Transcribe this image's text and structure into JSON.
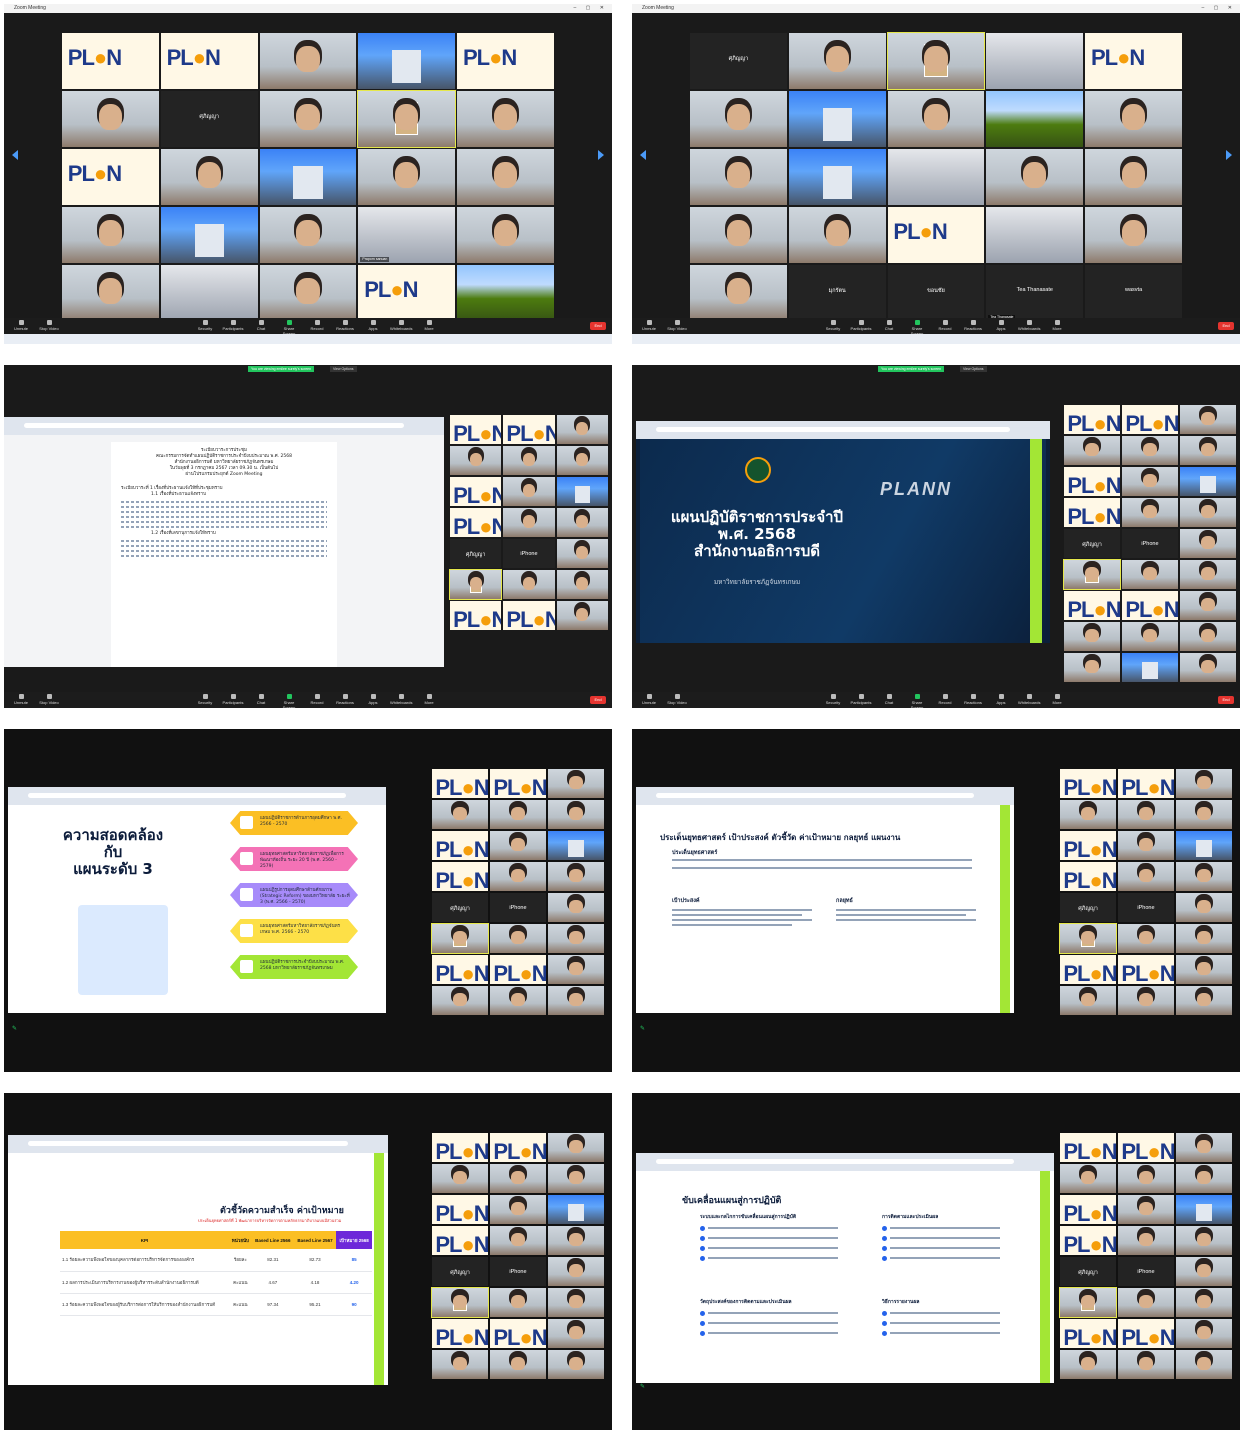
{
  "window_title": "Zoom Meeting",
  "toolbar": {
    "unmute": "Unmute",
    "stop_video": "Stop Video",
    "security": "Security",
    "participants": "Participants",
    "chat": "Chat",
    "share_screen": "Share Screen",
    "record": "Record",
    "reactions": "Reactions",
    "apps": "Apps",
    "whiteboards": "Whiteboards",
    "more": "More",
    "end": "End"
  },
  "screenshots": {
    "s1": {
      "tiles": [
        {
          "kind": "plan",
          "name": ""
        },
        {
          "kind": "plan",
          "name": ""
        },
        {
          "kind": "face",
          "name": ""
        },
        {
          "kind": "bldg",
          "name": ""
        },
        {
          "kind": "plan",
          "name": ""
        },
        {
          "kind": "face",
          "name": ""
        },
        {
          "kind": "dark",
          "big": "ศุภิญญา",
          "name": ""
        },
        {
          "kind": "face",
          "name": ""
        },
        {
          "kind": "active",
          "name": ""
        },
        {
          "kind": "face",
          "name": ""
        },
        {
          "kind": "plan",
          "name": ""
        },
        {
          "kind": "face",
          "name": ""
        },
        {
          "kind": "bldg",
          "name": ""
        },
        {
          "kind": "face",
          "name": ""
        },
        {
          "kind": "face",
          "name": ""
        },
        {
          "kind": "face",
          "name": ""
        },
        {
          "kind": "bldg",
          "name": ""
        },
        {
          "kind": "face",
          "name": ""
        },
        {
          "kind": "office",
          "name": "Praporn sanuan"
        },
        {
          "kind": "face",
          "name": ""
        },
        {
          "kind": "face",
          "name": ""
        },
        {
          "kind": "office",
          "name": ""
        },
        {
          "kind": "face",
          "name": ""
        },
        {
          "kind": "plan",
          "name": ""
        },
        {
          "kind": "mount",
          "name": ""
        }
      ]
    },
    "s2": {
      "tiles": [
        {
          "kind": "dark",
          "big": "ศุภิญญา",
          "name": ""
        },
        {
          "kind": "face",
          "name": ""
        },
        {
          "kind": "active",
          "name": ""
        },
        {
          "kind": "office",
          "name": ""
        },
        {
          "kind": "plan",
          "name": ""
        },
        {
          "kind": "face",
          "name": ""
        },
        {
          "kind": "bldg",
          "name": ""
        },
        {
          "kind": "face",
          "name": ""
        },
        {
          "kind": "mount",
          "name": ""
        },
        {
          "kind": "face",
          "name": ""
        },
        {
          "kind": "face",
          "name": ""
        },
        {
          "kind": "bldg",
          "name": ""
        },
        {
          "kind": "office",
          "name": ""
        },
        {
          "kind": "face",
          "name": ""
        },
        {
          "kind": "face",
          "name": ""
        },
        {
          "kind": "face",
          "name": ""
        },
        {
          "kind": "face",
          "name": ""
        },
        {
          "kind": "plan",
          "name": ""
        },
        {
          "kind": "office",
          "name": ""
        },
        {
          "kind": "face",
          "name": ""
        },
        {
          "kind": "face",
          "name": ""
        },
        {
          "kind": "dark",
          "big": "มุกรัตน",
          "name": ""
        },
        {
          "kind": "dark",
          "big": "ขอนชัย",
          "name": ""
        },
        {
          "kind": "dark",
          "big": "Tea Thanasate",
          "name": "Tea Thanasate"
        },
        {
          "kind": "dark",
          "big": "wasvta",
          "name": ""
        }
      ]
    },
    "s3": {
      "banner": "You are viewing emilee surely's screen",
      "view_options": "View Options",
      "doc_heading": "ระเบียบวาระการประชุม",
      "doc_line1": "คณะกรรมการจัดทำแผนปฏิบัติราชการประจำปีงบประมาณ พ.ศ. 2568",
      "doc_line2": "สำนักงานอธิการบดี มหาวิทยาลัยราชภัฏจันทรเกษม",
      "doc_line3": "ในวันพุธที่ 3 กรกฎาคม 2567 เวลา 09.30 น. เป็นต้นไป",
      "doc_line4": "ผ่านโปรแกรมประยุกต์ Zoom Meeting",
      "doc_agenda1": "ระเบียบวาระที่ 1 เรื่องที่ประธานแจ้งให้ที่ประชุมทราบ",
      "doc_sub1": "1.1 เรื่องที่ประธานแจ้งทราบ",
      "doc_sub2": "1.2 เรื่องที่เลขานุการแจ้งให้ทราบ",
      "side_names": [
        "ศุภิญญา",
        "iPhone",
        "ศักดิ์ชัย ศิริชัยกุล",
        "Praporn sanua..."
      ]
    },
    "s4": {
      "banner": "You are viewing emilee surely's screen",
      "view_options": "View Options",
      "slide_title_1": "แผนปฏิบัติราชการประจำปี",
      "slide_title_2": "พ.ศ. 2568",
      "slide_title_3": "สำนักงานอธิการบดี",
      "slide_sub": "มหาวิทยาลัยราชภัฏจันทรเกษม",
      "watermark": "PLANN",
      "side_names": [
        "ศุภิญญา",
        "iPhone",
        "มหาวิทยาลัยราชภัฏ..."
      ]
    },
    "s5": {
      "slide_title_1": "ความสอดคล้อง",
      "slide_title_2": "กับ",
      "slide_title_3": "แผนระดับ 3",
      "pills": [
        "แผนปฏิบัติราชการด้านการอุดมศึกษา พ.ศ. 2566 - 2570",
        "แผนยุทธศาสตร์มหาวิทยาลัยราชภัฏเพื่อการพัฒนาท้องถิ่น ระยะ 20 ปี (พ.ศ. 2560 - 2579)",
        "แผนปฏิรูปการอุดมศึกษาด้านศักยภาพ (Strategic Reform) ของมหาวิทยาลัย ระยะที่ 3 (พ.ศ. 2566 - 2570)",
        "แผนยุทธศาสตร์มหาวิทยาลัยราชภัฏจันทรเกษม พ.ศ. 2566 - 2570",
        "แผนปฏิบัติราชการประจำปีงบประมาณ พ.ศ. 2568 มหาวิทยาลัยราชภัฏจันทรเกษม"
      ],
      "side_names": [
        "ศุภิญญา",
        "iPhone",
        "มหาวิทยาลัยราชภัฏ..."
      ]
    },
    "s6": {
      "slide_heading": "ประเด็นยุทธศาสตร์ เป้าประสงค์ ตัวชี้วัด ค่าเป้าหมาย กลยุทธ์ แผนงาน",
      "sec1": "ประเด็นยุทธศาสตร์",
      "sec2": "เป้าประสงค์",
      "sec3": "กลยุทธ์",
      "side_names": [
        "ศุภิญญา",
        "iPhone",
        "มหาวิทยาลัยราชภัฏ..."
      ]
    },
    "s7": {
      "slide_heading": "ตัวชี้วัดความสำเร็จ ค่าเป้าหมาย",
      "slide_sub": "ประเด็นยุทธศาสตร์ที่ 1 พัฒนาการบริหารจัดการตามหลักธรรมาภิบาลแบบมีส่วนร่วม",
      "columns": [
        "KPI",
        "หน่วยนับ",
        "Based Line 2566",
        "Based Line 2567",
        "เป้าหมาย 2568"
      ],
      "rows": [
        [
          "1.1 ร้อยละความพึงพอใจของบุคลากรต่อการบริหารจัดการขององค์กร",
          "ร้อยละ",
          "82.31",
          "82.73",
          "85"
        ],
        [
          "1.2 ผลการประเมินการบริหารงานของผู้บริหารระดับสำนักงานอธิการบดี",
          "คะแนน",
          "4.67",
          "4.18",
          "4.20"
        ],
        [
          "1.3 ร้อยละความพึงพอใจของผู้รับบริการต่อการให้บริการของสำนักงานอธิการบดี",
          "คะแนน",
          "97.34",
          "95.21",
          "90"
        ]
      ],
      "side_names": [
        "ศุภิญญา",
        "iPhone",
        "Praporn sanua...",
        "Tea Thanasate",
        "มหาวิทยาลัยราชภัฏ..."
      ]
    },
    "s8": {
      "slide_heading": "ขับเคลื่อนแผนสู่การปฏิบัติ",
      "sec1": "ระบบและกลไกการขับเคลื่อนแผนสู่การปฏิบัติ",
      "sec2": "การติดตามและประเมินผล",
      "sec3": "วัตถุประสงค์ของการติดตามและประเมินผล",
      "sec4": "วิธีการรายงานผล",
      "side_names": [
        "ศุภิญญา",
        "iPhone",
        "มหาวิทยาลัยราชภัฏ..."
      ]
    }
  }
}
